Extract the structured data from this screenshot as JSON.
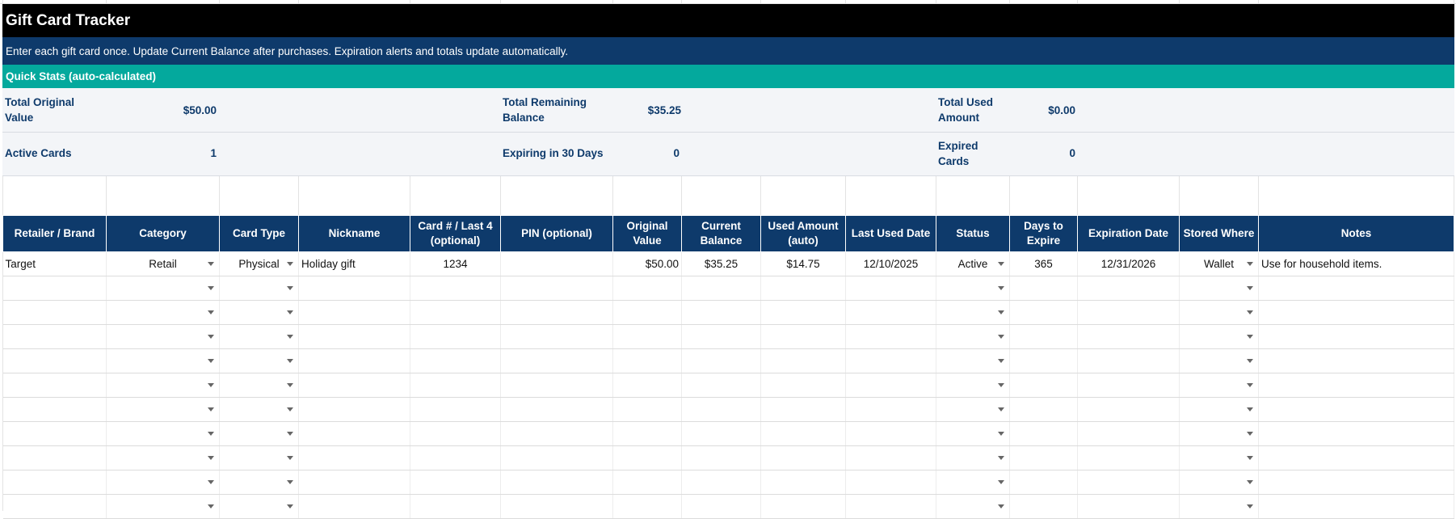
{
  "sheet": {
    "title": "Gift Card Tracker",
    "instructions": "Enter each gift card once. Update Current Balance after purchases. Expiration alerts and totals update automatically.",
    "quick_stats_header": "Quick Stats (auto-calculated)"
  },
  "stats": {
    "total_original_label": "Total Original Value",
    "total_original_value": "$50.00",
    "total_remaining_label": "Total Remaining Balance",
    "total_remaining_value": "$35.25",
    "total_used_label": "Total Used Amount",
    "total_used_value": "$0.00",
    "active_cards_label": "Active Cards",
    "active_cards_value": "1",
    "expiring_label": "Expiring in 30 Days",
    "expiring_value": "0",
    "expired_label": "Expired Cards",
    "expired_value": "0"
  },
  "table": {
    "headers": [
      "Retailer / Brand",
      "Category",
      "Card Type",
      "Nickname",
      "Card # / Last 4 (optional)",
      "PIN (optional)",
      "Original Value",
      "Current Balance",
      "Used Amount (auto)",
      "Last Used Date",
      "Status",
      "Days to Expire",
      "Expiration Date",
      "Stored Where",
      "Notes"
    ],
    "rows": [
      {
        "retailer": "Target",
        "category": "Retail",
        "card_type": "Physical",
        "nickname": "Holiday gift",
        "card_last4": "1234",
        "pin": "",
        "original_value": "$50.00",
        "current_balance": "$35.25",
        "used_amount": "$14.75",
        "last_used_date": "12/10/2025",
        "status": "Active",
        "days_to_expire": "365",
        "expiration_date": "12/31/2026",
        "stored_where": "Wallet",
        "notes": "Use for household items."
      },
      {
        "retailer": "",
        "category": "",
        "card_type": "",
        "nickname": "",
        "card_last4": "",
        "pin": "",
        "original_value": "",
        "current_balance": "",
        "used_amount": "",
        "last_used_date": "",
        "status": "",
        "days_to_expire": "",
        "expiration_date": "",
        "stored_where": "",
        "notes": ""
      },
      {
        "retailer": "",
        "category": "",
        "card_type": "",
        "nickname": "",
        "card_last4": "",
        "pin": "",
        "original_value": "",
        "current_balance": "",
        "used_amount": "",
        "last_used_date": "",
        "status": "",
        "days_to_expire": "",
        "expiration_date": "",
        "stored_where": "",
        "notes": ""
      },
      {
        "retailer": "",
        "category": "",
        "card_type": "",
        "nickname": "",
        "card_last4": "",
        "pin": "",
        "original_value": "",
        "current_balance": "",
        "used_amount": "",
        "last_used_date": "",
        "status": "",
        "days_to_expire": "",
        "expiration_date": "",
        "stored_where": "",
        "notes": ""
      },
      {
        "retailer": "",
        "category": "",
        "card_type": "",
        "nickname": "",
        "card_last4": "",
        "pin": "",
        "original_value": "",
        "current_balance": "",
        "used_amount": "",
        "last_used_date": "",
        "status": "",
        "days_to_expire": "",
        "expiration_date": "",
        "stored_where": "",
        "notes": ""
      },
      {
        "retailer": "",
        "category": "",
        "card_type": "",
        "nickname": "",
        "card_last4": "",
        "pin": "",
        "original_value": "",
        "current_balance": "",
        "used_amount": "",
        "last_used_date": "",
        "status": "",
        "days_to_expire": "",
        "expiration_date": "",
        "stored_where": "",
        "notes": ""
      },
      {
        "retailer": "",
        "category": "",
        "card_type": "",
        "nickname": "",
        "card_last4": "",
        "pin": "",
        "original_value": "",
        "current_balance": "",
        "used_amount": "",
        "last_used_date": "",
        "status": "",
        "days_to_expire": "",
        "expiration_date": "",
        "stored_where": "",
        "notes": ""
      },
      {
        "retailer": "",
        "category": "",
        "card_type": "",
        "nickname": "",
        "card_last4": "",
        "pin": "",
        "original_value": "",
        "current_balance": "",
        "used_amount": "",
        "last_used_date": "",
        "status": "",
        "days_to_expire": "",
        "expiration_date": "",
        "stored_where": "",
        "notes": ""
      },
      {
        "retailer": "",
        "category": "",
        "card_type": "",
        "nickname": "",
        "card_last4": "",
        "pin": "",
        "original_value": "",
        "current_balance": "",
        "used_amount": "",
        "last_used_date": "",
        "status": "",
        "days_to_expire": "",
        "expiration_date": "",
        "stored_where": "",
        "notes": ""
      },
      {
        "retailer": "",
        "category": "",
        "card_type": "",
        "nickname": "",
        "card_last4": "",
        "pin": "",
        "original_value": "",
        "current_balance": "",
        "used_amount": "",
        "last_used_date": "",
        "status": "",
        "days_to_expire": "",
        "expiration_date": "",
        "stored_where": "",
        "notes": ""
      },
      {
        "retailer": "",
        "category": "",
        "card_type": "",
        "nickname": "",
        "card_last4": "",
        "pin": "",
        "original_value": "",
        "current_balance": "",
        "used_amount": "",
        "last_used_date": "",
        "status": "",
        "days_to_expire": "",
        "expiration_date": "",
        "stored_where": "",
        "notes": ""
      }
    ]
  },
  "colors": {
    "title_bg": "#000000",
    "instructions_bg": "#0e3a6b",
    "quick_stats_bg": "#04a99d",
    "stats_text": "#0e3a6b",
    "header_bg": "#0e3a6b"
  },
  "icons": {
    "dropdown": "chevron-down-icon"
  }
}
